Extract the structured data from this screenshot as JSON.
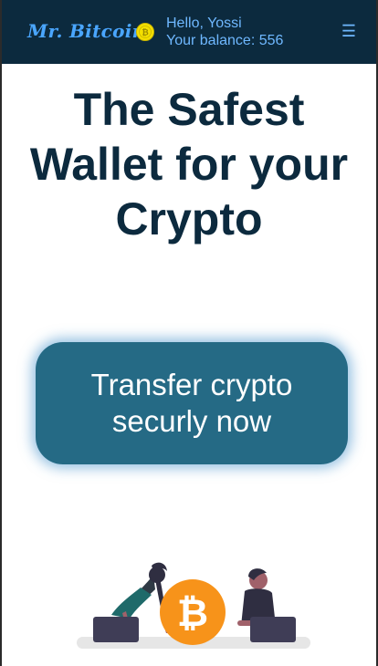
{
  "header": {
    "logo": "Mr. Bitcoin",
    "greeting": "Hello, Yossi",
    "balance_text": "Your balance: 556",
    "menu_glyph": "☰",
    "coin_icon": "bitcoin-coin-icon"
  },
  "hero": {
    "title": "The Safest Wallet for your Crypto"
  },
  "cta": {
    "label": "Transfer crypto securly now"
  },
  "illustration": {
    "coin_glyph": "₿"
  },
  "colors": {
    "header_bg": "#0c2a3e",
    "accent": "#4aa6ff",
    "title": "#0c2a3e",
    "button": "#256a85",
    "bitcoin": "#f7931a"
  }
}
